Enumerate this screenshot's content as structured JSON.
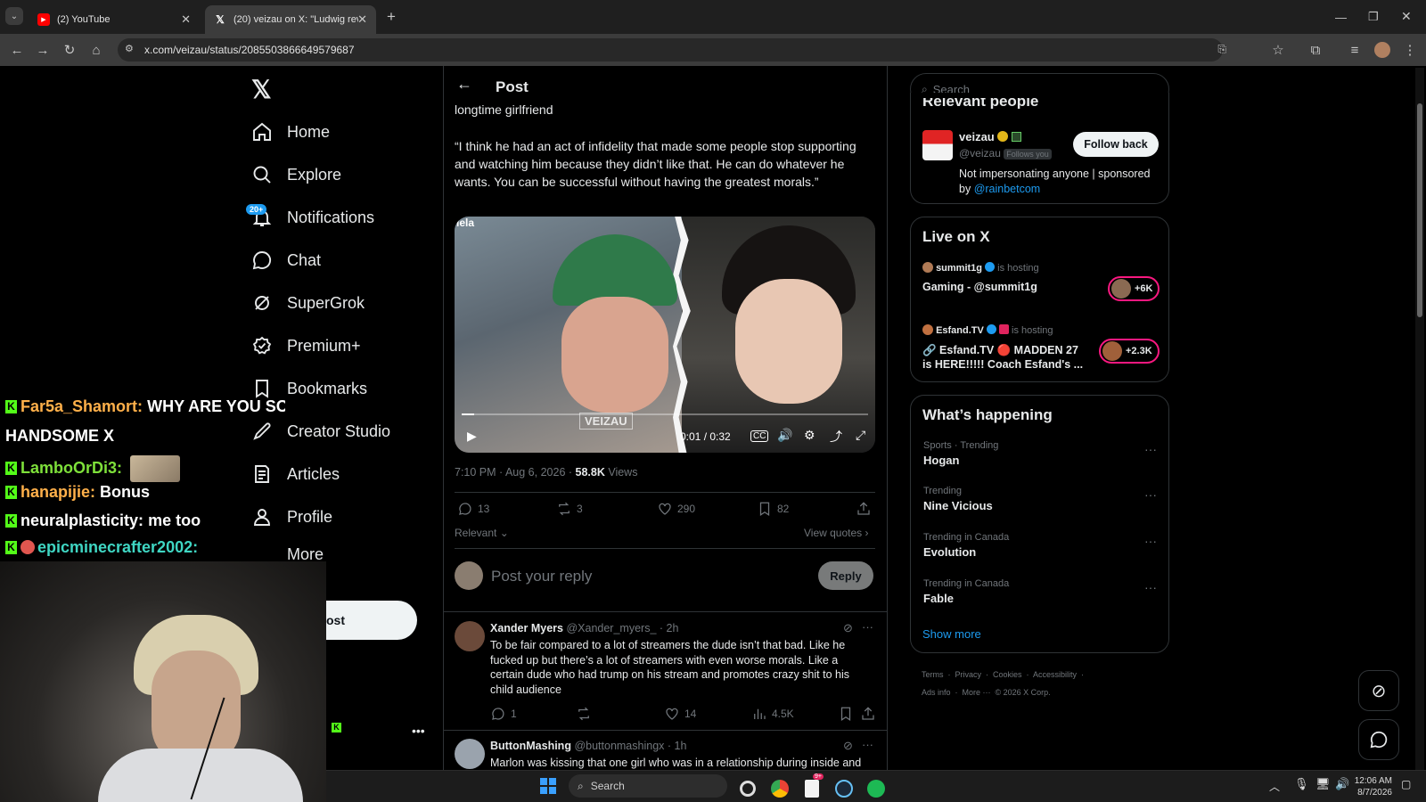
{
  "browser": {
    "tabs": [
      {
        "label": "(2) YouTube",
        "icon": "youtube-icon",
        "close": "✕"
      },
      {
        "label": "(20) veizau on X: \"Ludwig revea",
        "icon": "x-logo-icon",
        "close": "✕"
      }
    ],
    "new_tab": "+",
    "url": "x.com/veizau/status/2085503866649579687"
  },
  "sidebar": {
    "logo": "𝕏",
    "notification_badge": "20+",
    "items": [
      {
        "label": "Home",
        "icon": "home-icon"
      },
      {
        "label": "Explore",
        "icon": "search-icon"
      },
      {
        "label": "Notifications",
        "icon": "bell-icon"
      },
      {
        "label": "Chat",
        "icon": "chat-icon"
      },
      {
        "label": "SuperGrok",
        "icon": "grok-icon"
      },
      {
        "label": "Premium+",
        "icon": "premium-icon"
      },
      {
        "label": "Bookmarks",
        "icon": "bookmark-icon"
      },
      {
        "label": "Creator Studio",
        "icon": "creator-icon"
      },
      {
        "label": "Articles",
        "icon": "articles-icon"
      },
      {
        "label": "Profile",
        "icon": "profile-icon"
      },
      {
        "label": "More",
        "icon": "more-icon"
      }
    ],
    "post_button": "ost",
    "account_menu": "•••"
  },
  "stream_chat": [
    {
      "user": "Far5a_Shamort:",
      "msg": "WHY ARE YOU SO",
      "color": "#ffb04a"
    },
    {
      "user": "",
      "msg": "HANDSOME X",
      "color": "#ffffff"
    },
    {
      "user": "LamboOrDi3:",
      "msg": "",
      "color": "#7ee03a"
    },
    {
      "user": "hanapijie:",
      "msg": "Bonus",
      "color": "#ffb04a"
    },
    {
      "user": "neuralplasticity:",
      "msg": "me too",
      "color": "#ffffff"
    },
    {
      "user": "epicminecrafter2002:",
      "msg": "",
      "color": "#3fd6c3"
    }
  ],
  "post": {
    "header": "Post",
    "text_fragment": "longtime girlfriend",
    "quote": "“I think he had an act of infidelity that made some people stop supporting and watching him because they didn’t like that. He can do whatever he wants. You can be successful without having the greatest morals.”",
    "video": {
      "overlay_left": "ıela",
      "watermark": "VEIZAU",
      "time": "0:01 / 0:32",
      "progress": 0.03
    },
    "timestamp": "7:10 PM · Aug 6, 2026 · ",
    "views_count": "58.8K",
    "views_label": " Views",
    "actions": {
      "replies": "13",
      "reposts": "3",
      "likes": "290",
      "bookmarks": "82"
    },
    "sort": "Relevant",
    "view_quotes": "View quotes",
    "reply_placeholder": "Post your reply",
    "reply_button": "Reply"
  },
  "replies": [
    {
      "name": "Xander Myers",
      "handle": "@Xander_myers_ · 2h",
      "text": "To be fair compared to a lot of streamers the dude isn’t that bad. Like he fucked up but there’s a lot of streamers with even worse morals. Like a certain dude who had trump on his stream and promotes crazy shit to his child audience",
      "replies": "1",
      "reposts": "",
      "likes": "14",
      "views": "4.5K"
    },
    {
      "name": "ButtonMashing",
      "handle": "@buttonmashingx · 1h",
      "text": "Marlon was kissing that one girl who was in a relationship during inside and"
    }
  ],
  "right": {
    "search_placeholder": "Search",
    "relevant_title": "Relevant people",
    "person": {
      "name": "veizau",
      "handle": "@veizau",
      "follows_you": "Follows you",
      "follow_button": "Follow back",
      "bio": "Not impersonating anyone | sponsored by ",
      "bio_link": "@rainbetcom"
    },
    "live_title": "Live on X",
    "live": [
      {
        "host": "summit1g",
        "status": "is hosting",
        "title": "Gaming - @summit1g",
        "count": "+6K"
      },
      {
        "host": "Esfand.TV",
        "status": "is hosting",
        "title": "🔗 Esfand.TV 🔴 MADDEN 27 is HERE!!!!! Coach Esfand's ...",
        "count": "+2.3K"
      }
    ],
    "happening_title": "What’s happening",
    "trends": [
      {
        "category": "Sports · Trending",
        "name": "Hogan"
      },
      {
        "category": "Trending",
        "name": "Nine Vicious"
      },
      {
        "category": "Trending in Canada",
        "name": "Evolution"
      },
      {
        "category": "Trending in Canada",
        "name": "Fable"
      }
    ],
    "show_more": "Show more",
    "footer_line1": "Terms  ·  Privacy  ·  Cookies  ·  Accessibility  ·",
    "footer_line2": "Ads info  ·  More ···  © 2026 X Corp."
  },
  "taskbar": {
    "search_placeholder": "Search",
    "time": "12:06 AM",
    "date": "8/7/2026",
    "notif_badge": "9+"
  }
}
